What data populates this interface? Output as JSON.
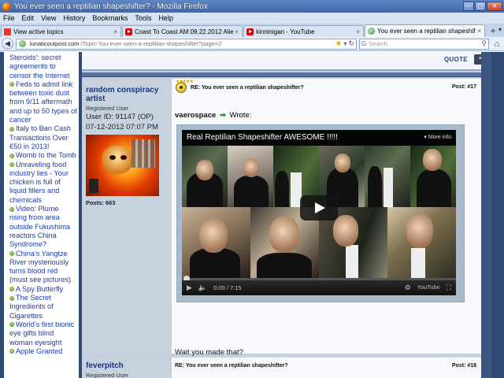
{
  "window": {
    "title": "You ever seen a reptilian shapeshifter? - Mozilla Firefox",
    "buttons": {
      "minimize": "–",
      "maximize": "▢",
      "close": "✕"
    }
  },
  "menu": [
    "File",
    "Edit",
    "View",
    "History",
    "Bookmarks",
    "Tools",
    "Help"
  ],
  "tabs": [
    {
      "label": "View active topics",
      "icon": "doc-icon",
      "active": false
    },
    {
      "label": "Coast To Coast AM 09.22.2012 Alien Visi...",
      "icon": "youtube-icon",
      "active": false
    },
    {
      "label": "kinninigan - YouTube",
      "icon": "youtube-icon",
      "active": false
    },
    {
      "label": "You ever seen a reptilian shapeshifter?",
      "icon": "globe-icon",
      "active": true
    }
  ],
  "tab_close": "×",
  "new_tab": "+",
  "nav": {
    "url_host": "lunaticoutpost.com",
    "url_path": "/Topic-You-ever-seen-a-reptilian-shapeshifter?page=2",
    "search_placeholder": "Search",
    "search_engine": "G"
  },
  "sidebar": {
    "items": [
      {
        "bullet": false,
        "text": "Steroids': secret agreements to censor the Internet"
      },
      {
        "bullet": true,
        "text": "Feds to admit link between toxic dust from 9/11 aftermath and up to 50 types of cancer"
      },
      {
        "bullet": true,
        "text": "Italy to Ban Cash Transactions Over €50 in 2013!"
      },
      {
        "bullet": true,
        "text": "Womb to the Tomb"
      },
      {
        "bullet": true,
        "text": "Unraveling food industry lies - Your chicken is full of liquid fillers and chemicals"
      },
      {
        "bullet": true,
        "text": "Video: Plume rising from area outside Fukushima reactors China Syndrome?"
      },
      {
        "bullet": true,
        "text": "China's Yangtze River mysteriously turns blood red (must see pictures)"
      },
      {
        "bullet": true,
        "text": "A Spy Butterfly"
      },
      {
        "bullet": true,
        "text": "The Secret Ingredients of Cigarettes"
      },
      {
        "bullet": true,
        "text": "World's first bionic eye gifts blind woman eyesight"
      },
      {
        "bullet": true,
        "text": "Apple Granted"
      }
    ]
  },
  "quote_label": "QUOTE",
  "post17": {
    "author": "random conspiracy artist",
    "rank": "Registered User",
    "user_id": "User ID: 91147 (OP)",
    "date": "07-12-2012 07:07 PM",
    "posts": "Posts: 663",
    "re_title": "RE: You ever seen a reptilian shapeshifter?",
    "post_number": "Post: #17",
    "quoted_user": "vaerospace",
    "wrote": "Wrote:",
    "reply_text": "Wait you made that?",
    "video": {
      "title": "Real Reptilian Shapeshifter AWESOME !!!!!",
      "more_info": "More info",
      "time": "0:00 / 7:15",
      "brand": "YouTube"
    }
  },
  "post18": {
    "author": "feverpitch",
    "rank": "Registered User",
    "re_title": "RE: You ever seen a reptilian shapeshifter?",
    "post_number": "Post: #18"
  }
}
